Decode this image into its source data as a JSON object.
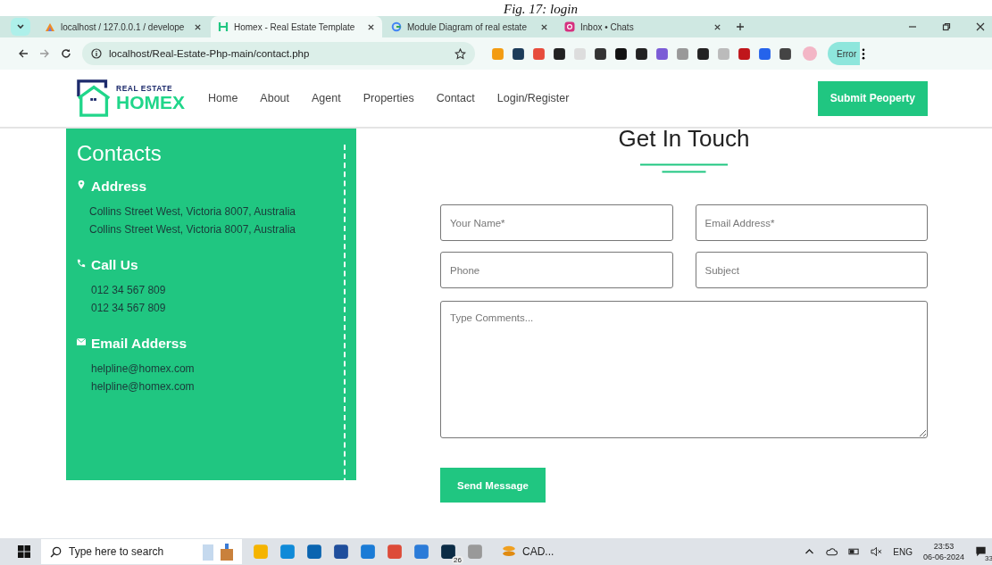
{
  "caption": "Fig. 17: login",
  "browser": {
    "tabs": [
      {
        "title": "localhost / 127.0.0.1 / develope",
        "selected": false
      },
      {
        "title": "Homex - Real Estate Template",
        "selected": true
      },
      {
        "title": "Module Diagram of real estate",
        "selected": false
      },
      {
        "title": "Inbox • Chats",
        "selected": false
      }
    ],
    "url": "localhost/Real-Estate-Php-main/contact.php",
    "profile_button": "Error"
  },
  "site": {
    "logo": {
      "tagline": "REAL ESTATE",
      "name": "HOMEX"
    },
    "nav": [
      "Home",
      "About",
      "Agent",
      "Properties",
      "Contact",
      "Login/Register"
    ],
    "submit_button": "Submit Peoperty"
  },
  "contacts": {
    "title": "Contacts",
    "sections": [
      {
        "heading": "Address",
        "lines": [
          "Collins Street West, Victoria 8007, Australia",
          "Collins Street West, Victoria 8007, Australia"
        ]
      },
      {
        "heading": "Call Us",
        "lines": [
          "012 34 567 809",
          "012 34 567 809"
        ]
      },
      {
        "heading": "Email Adderss",
        "lines": [
          "helpline@homex.com",
          "helpline@homex.com"
        ]
      }
    ]
  },
  "form": {
    "title": "Get In Touch",
    "fields": [
      {
        "kind": "input",
        "placeholder": "Your Name*"
      },
      {
        "kind": "input",
        "placeholder": "Email Address*"
      },
      {
        "kind": "input",
        "placeholder": "Phone"
      },
      {
        "kind": "input",
        "placeholder": "Subject"
      },
      {
        "kind": "textarea",
        "placeholder": "Type Comments..."
      }
    ],
    "button": "Send Message"
  },
  "taskbar": {
    "search_placeholder": "Type here to search",
    "whatsapp_badge": "26",
    "app_label": "CAD...",
    "language": "ENG",
    "time": "23:53",
    "date": "06-06-2024",
    "notifications": "33"
  }
}
